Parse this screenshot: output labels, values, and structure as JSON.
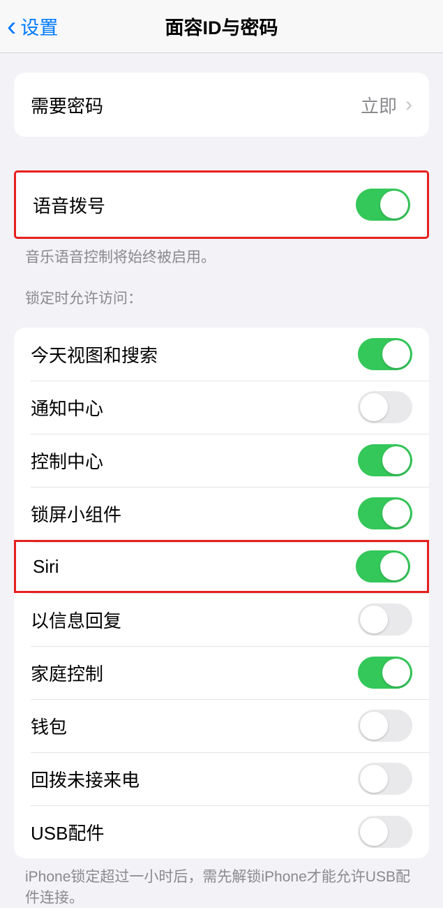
{
  "nav": {
    "back_label": "设置",
    "title": "面容ID与密码"
  },
  "section1": {
    "require_passcode": {
      "label": "需要密码",
      "value": "立即"
    }
  },
  "section2": {
    "voice_dial": {
      "label": "语音拨号",
      "on": true
    },
    "footer": "音乐语音控制将始终被启用。"
  },
  "section3": {
    "header": "锁定时允许访问：",
    "items": [
      {
        "label": "今天视图和搜索",
        "on": true
      },
      {
        "label": "通知中心",
        "on": false
      },
      {
        "label": "控制中心",
        "on": true
      },
      {
        "label": "锁屏小组件",
        "on": true
      },
      {
        "label": "Siri",
        "on": true,
        "highlight": true
      },
      {
        "label": "以信息回复",
        "on": false
      },
      {
        "label": "家庭控制",
        "on": true
      },
      {
        "label": "钱包",
        "on": false
      },
      {
        "label": "回拨未接来电",
        "on": false
      },
      {
        "label": "USB配件",
        "on": false
      }
    ],
    "footer": "iPhone锁定超过一小时后，需先解锁iPhone才能允许USB配件连接。"
  }
}
